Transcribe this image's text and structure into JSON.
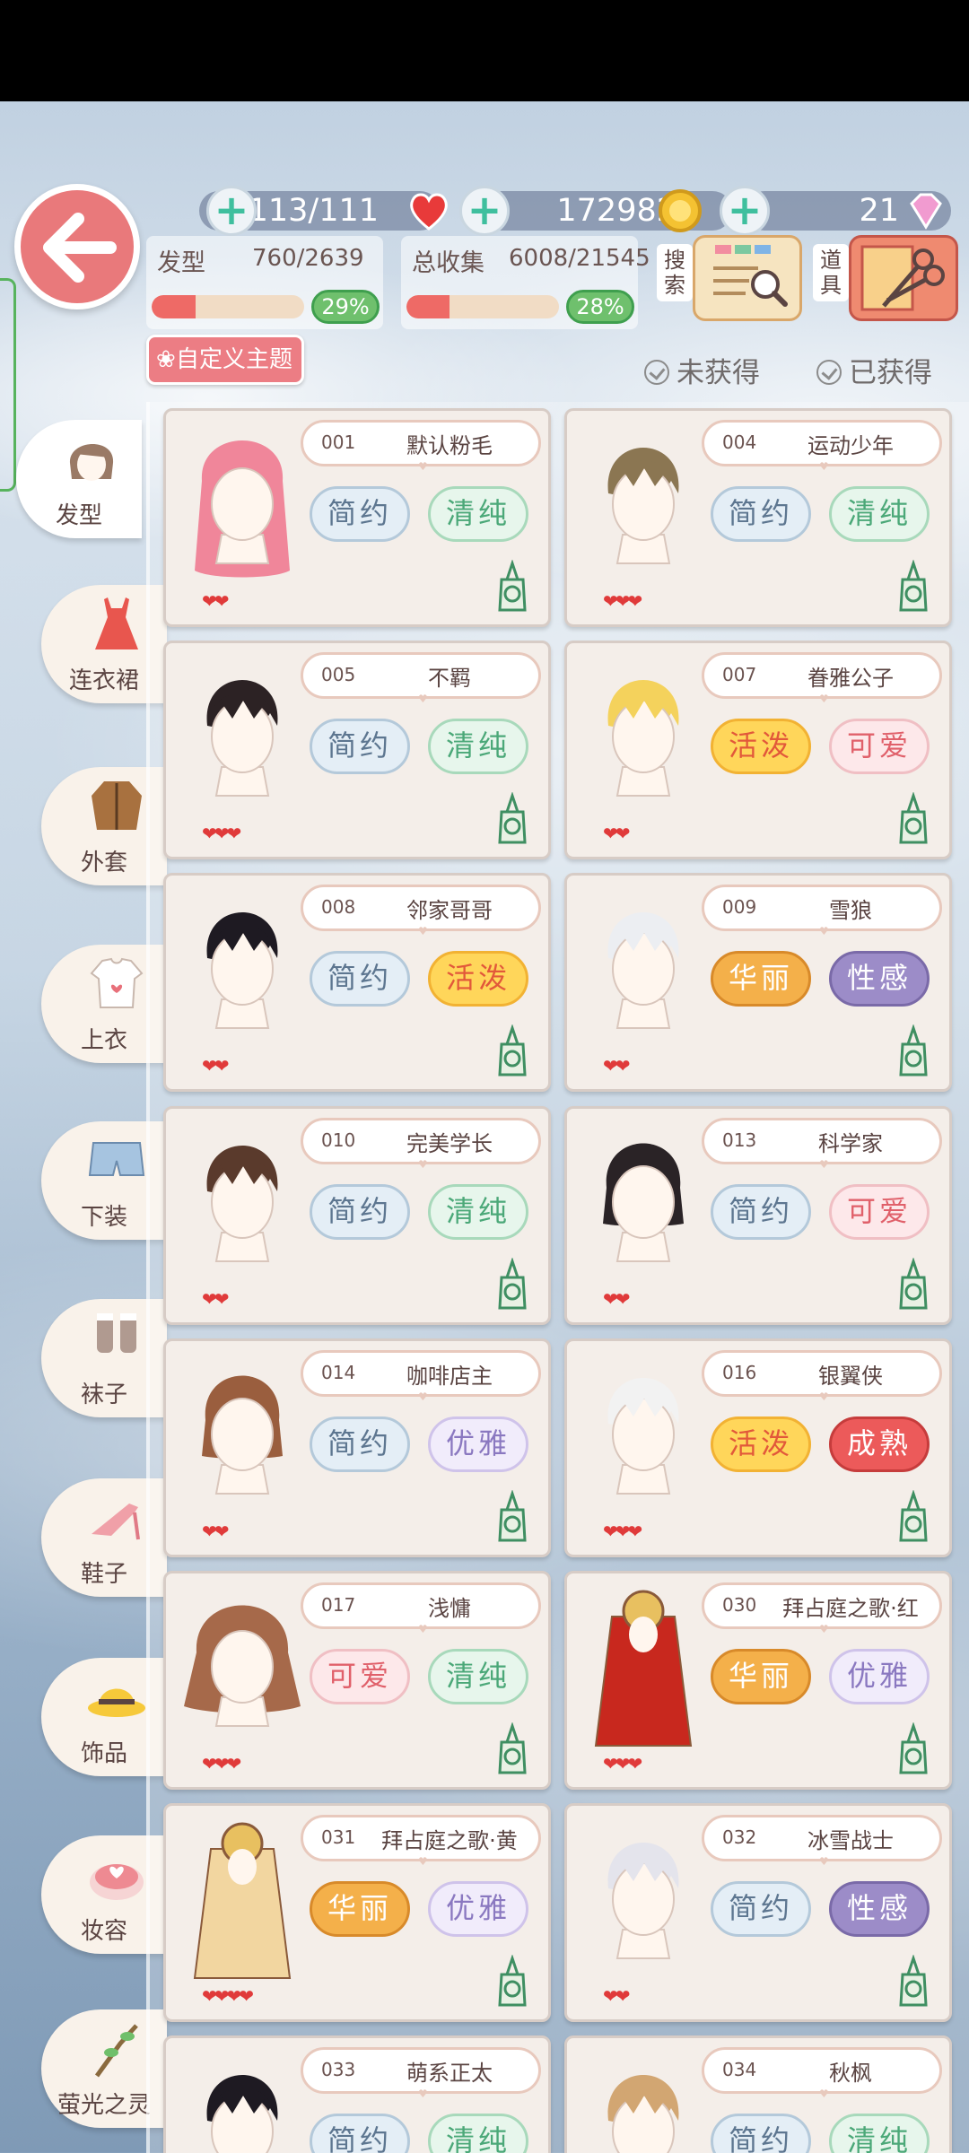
{
  "stats": {
    "hearts": "113/111",
    "gold": "172982",
    "diamonds": "21"
  },
  "progress": {
    "hairstyle": {
      "label": "发型",
      "value": "760/2639",
      "percent_text": "29%",
      "fraction": 0.29
    },
    "total": {
      "label": "总收集",
      "value": "6008/21545",
      "percent_text": "28%",
      "fraction": 0.28
    }
  },
  "tools": {
    "search": "搜索",
    "props": "道具"
  },
  "custom_theme": "自定义主题",
  "filters": {
    "not_obtained": "未获得",
    "obtained": "已获得"
  },
  "sidebar": [
    {
      "label": "发型",
      "icon": "hair-icon"
    },
    {
      "label": "连衣裙",
      "icon": "dress-icon"
    },
    {
      "label": "外套",
      "icon": "coat-icon"
    },
    {
      "label": "上衣",
      "icon": "shirt-icon"
    },
    {
      "label": "下装",
      "icon": "shorts-icon"
    },
    {
      "label": "袜子",
      "icon": "socks-icon"
    },
    {
      "label": "鞋子",
      "icon": "shoes-icon"
    },
    {
      "label": "饰品",
      "icon": "hat-icon"
    },
    {
      "label": "妆容",
      "icon": "makeup-icon"
    },
    {
      "label": "萤光之灵",
      "icon": "branch-icon"
    }
  ],
  "items": [
    {
      "id": "001",
      "name": "默认粉毛",
      "tags": [
        "简约",
        "清纯"
      ],
      "hearts": "❤❤",
      "hair": "#f0869a",
      "style": "long"
    },
    {
      "id": "004",
      "name": "运动少年",
      "tags": [
        "简约",
        "清纯"
      ],
      "hearts": "❤❤❤",
      "hair": "#8b7652",
      "style": "short"
    },
    {
      "id": "005",
      "name": "不羁",
      "tags": [
        "简约",
        "清纯"
      ],
      "hearts": "❤❤❤",
      "hair": "#2c2224",
      "style": "short"
    },
    {
      "id": "007",
      "name": "眷雅公子",
      "tags": [
        "活泼",
        "可爱"
      ],
      "hearts": "❤❤",
      "hair": "#f4d25c",
      "style": "short"
    },
    {
      "id": "008",
      "name": "邻家哥哥",
      "tags": [
        "简约",
        "活泼"
      ],
      "hearts": "❤❤",
      "hair": "#1e1a22",
      "style": "short"
    },
    {
      "id": "009",
      "name": "雪狼",
      "tags": [
        "华丽",
        "性感"
      ],
      "hearts": "❤❤",
      "hair": "#eceef2",
      "style": "short"
    },
    {
      "id": "010",
      "name": "完美学长",
      "tags": [
        "简约",
        "清纯"
      ],
      "hearts": "❤❤",
      "hair": "#5a3a2c",
      "style": "short"
    },
    {
      "id": "013",
      "name": "科学家",
      "tags": [
        "简约",
        "可爱"
      ],
      "hearts": "❤❤",
      "hair": "#2a2326",
      "style": "mid"
    },
    {
      "id": "014",
      "name": "咖啡店主",
      "tags": [
        "简约",
        "优雅"
      ],
      "hearts": "❤❤",
      "hair": "#9a5e3e",
      "style": "mid"
    },
    {
      "id": "016",
      "name": "银翼侠",
      "tags": [
        "活泼",
        "成熟"
      ],
      "hearts": "❤❤❤",
      "hair": "#f2f2f2",
      "style": "short"
    },
    {
      "id": "017",
      "name": "浅慵",
      "tags": [
        "可爱",
        "清纯"
      ],
      "hearts": "❤❤❤",
      "hair": "#a6694a",
      "style": "bob"
    },
    {
      "id": "030",
      "name": "拜占庭之歌·红",
      "tags": [
        "华丽",
        "优雅"
      ],
      "hearts": "❤❤❤",
      "hair": "#c8281e",
      "style": "veil"
    },
    {
      "id": "031",
      "name": "拜占庭之歌·黄",
      "tags": [
        "华丽",
        "优雅"
      ],
      "hearts": "❤❤❤❤",
      "hair": "#f2d6a0",
      "style": "veil"
    },
    {
      "id": "032",
      "name": "冰雪战士",
      "tags": [
        "简约",
        "性感"
      ],
      "hearts": "❤❤",
      "hair": "#e4e4ec",
      "style": "short"
    },
    {
      "id": "033",
      "name": "萌系正太",
      "tags": [
        "简约",
        "清纯"
      ],
      "hearts": "",
      "hair": "#1e1a22",
      "style": "short"
    },
    {
      "id": "034",
      "name": "秋枫",
      "tags": [
        "简约",
        "清纯"
      ],
      "hearts": "",
      "hair": "#d2a672",
      "style": "short"
    }
  ],
  "tag_colors": {
    "简约": "t-blue",
    "清纯": "t-green",
    "活泼": "t-yellow",
    "可爱": "t-pink",
    "华丽": "t-orange",
    "性感": "t-purple",
    "优雅": "t-lav",
    "成熟": "t-red"
  }
}
